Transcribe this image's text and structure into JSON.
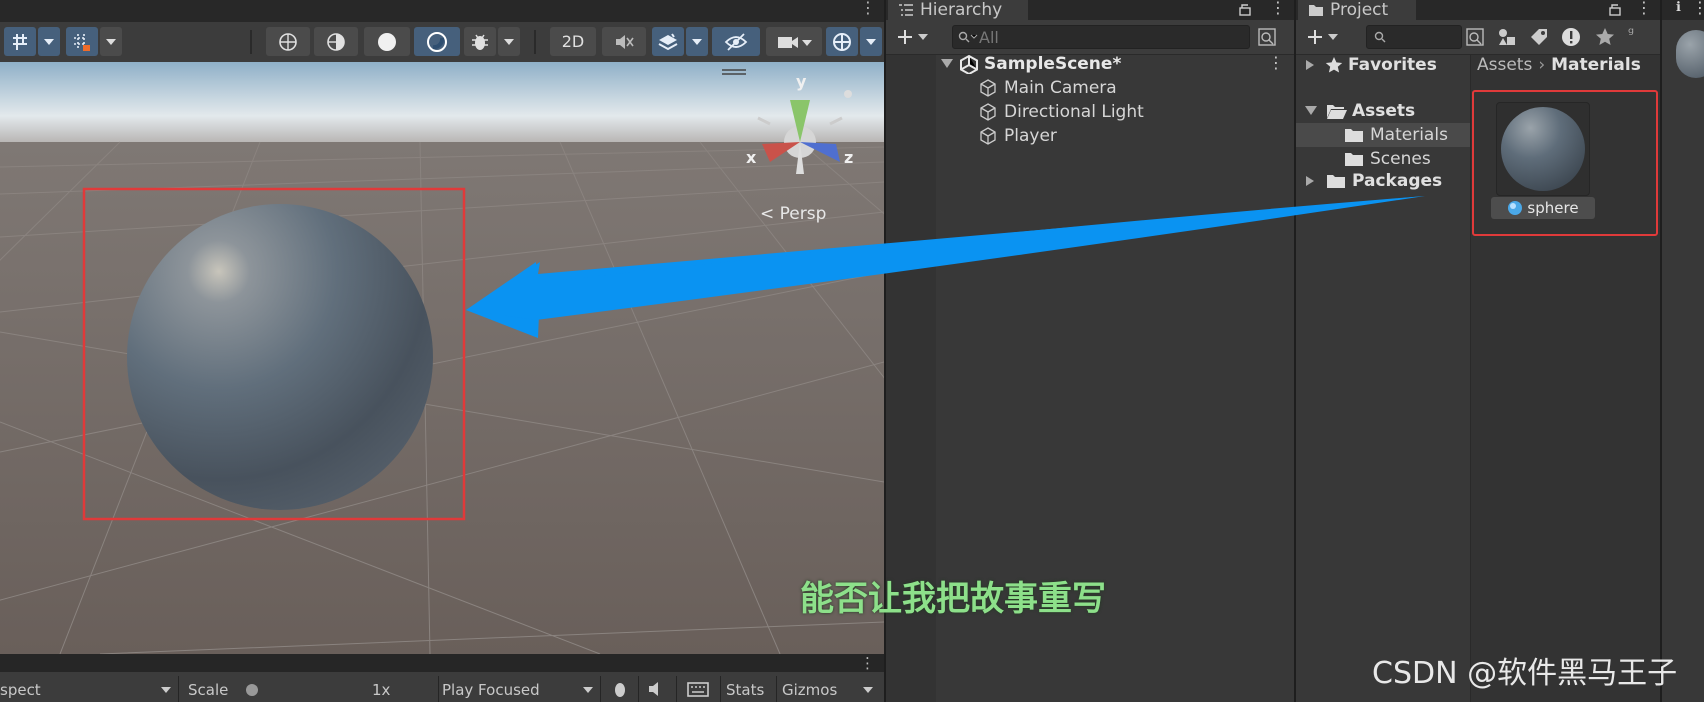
{
  "scene_toolbar": {
    "btn_2d": "2D",
    "gizmo_labels": {
      "y": "y",
      "x": "x",
      "z": "z"
    },
    "persp_label": "< Persp"
  },
  "game_toolbar": {
    "aspect": "spect",
    "scale_label": "Scale",
    "scale_value": "1x",
    "play_mode": "Play Focused",
    "stats": "Stats",
    "gizmos": "Gizmos"
  },
  "subtitle": "能否让我把故事重写",
  "hierarchy": {
    "tab_label": "Hierarchy",
    "search_placeholder": "All",
    "scene_name": "SampleScene*",
    "items": [
      {
        "label": "Main Camera"
      },
      {
        "label": "Directional Light"
      },
      {
        "label": "Player"
      }
    ]
  },
  "project": {
    "tab_label": "Project",
    "tree": {
      "favorites": "Favorites",
      "assets": "Assets",
      "materials": "Materials",
      "scenes": "Scenes",
      "packages": "Packages"
    },
    "breadcrumb": {
      "root": "Assets",
      "current": "Materials"
    },
    "asset": {
      "name": "sphere"
    }
  },
  "watermark": "CSDN @软件黑马王子",
  "colors": {
    "highlight_box": "#e03a3a",
    "arrow": "#0a93f2",
    "subtitle": "#8de08a",
    "active_button": "#46607c"
  }
}
